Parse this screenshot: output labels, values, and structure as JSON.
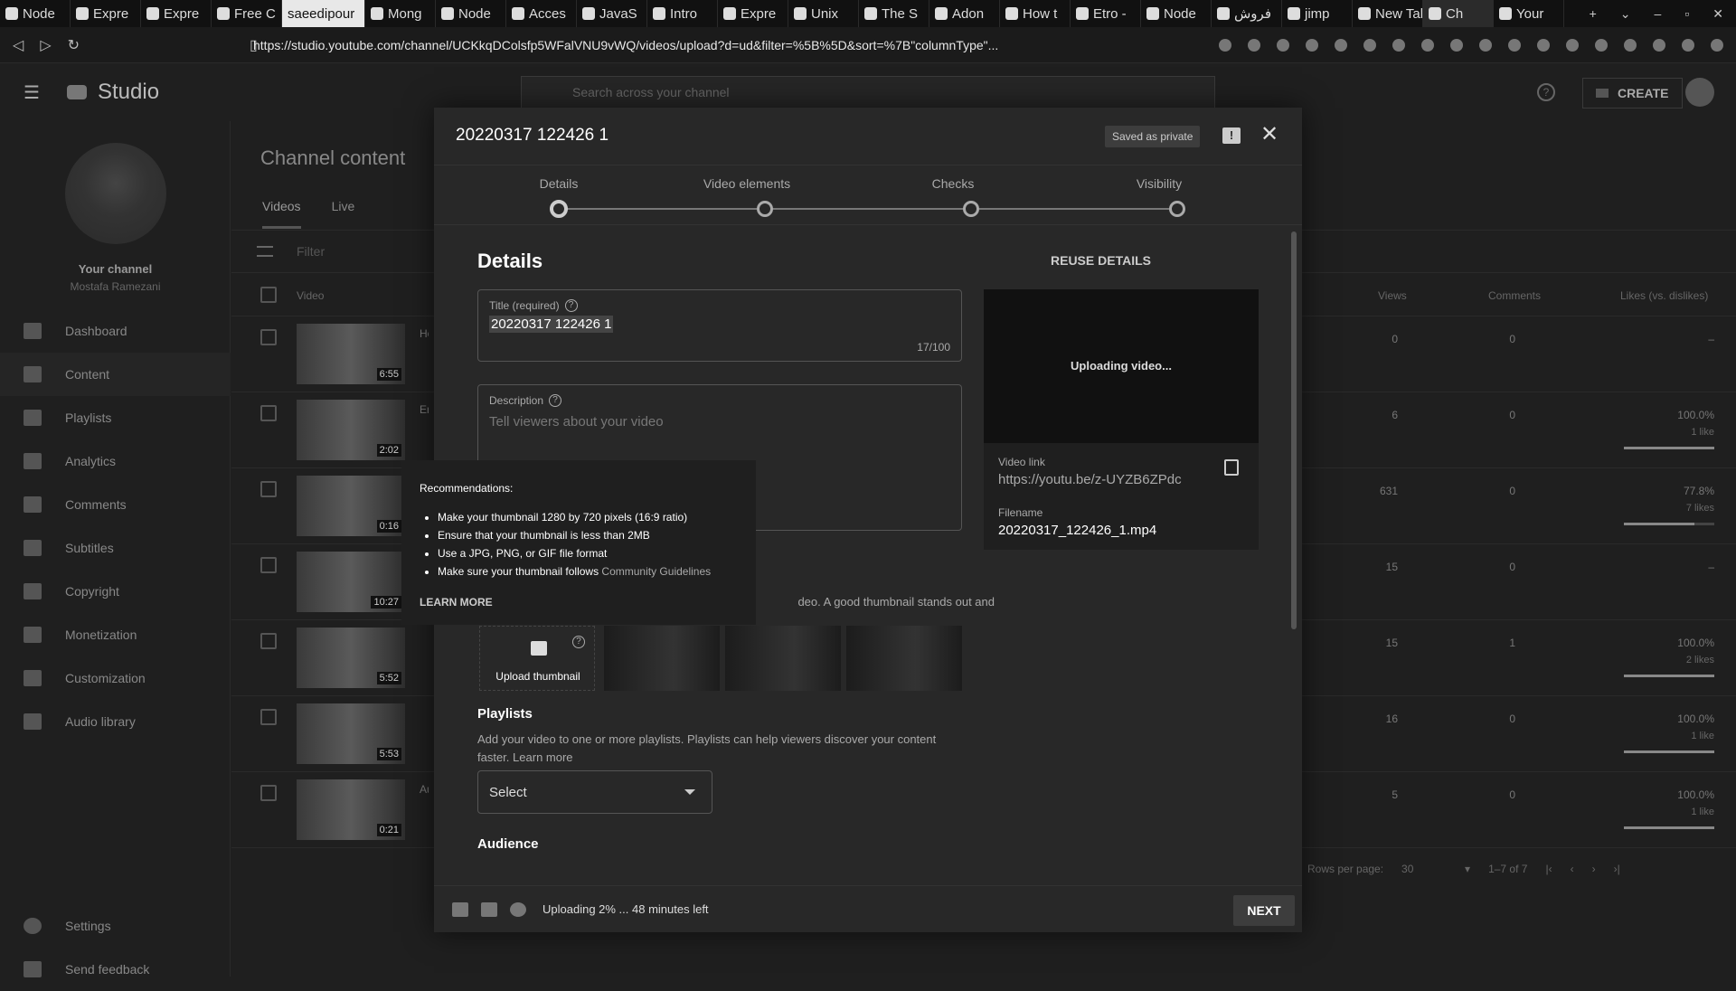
{
  "browser": {
    "tabs": [
      "Node",
      "Expre",
      "Expre",
      "Free C",
      "saeedipour",
      "Mong",
      "Node",
      "Acces",
      "JavaS",
      "Intro",
      "Expre",
      "Unix",
      "The S",
      "Adon",
      "How t",
      "Etro -",
      "Node",
      "فروش",
      "jimp",
      "New Tab",
      "Ch",
      "Your"
    ],
    "active_tab_index": 4,
    "url": "https://studio.youtube.com/channel/UCKkqDColsfp5WFalVNU9vWQ/videos/upload?d=ud&filter=%5B%5D&sort=%7B\"columnType\"..."
  },
  "studio": {
    "logo_text": "Studio",
    "search_placeholder": "Search across your channel",
    "create_label": "CREATE"
  },
  "sidebar": {
    "channel_title": "Your channel",
    "channel_name": "Mostafa Ramezani",
    "items": [
      {
        "label": "Dashboard",
        "icon": "dashboard-icon"
      },
      {
        "label": "Content",
        "icon": "content-icon"
      },
      {
        "label": "Playlists",
        "icon": "playlists-icon"
      },
      {
        "label": "Analytics",
        "icon": "analytics-icon"
      },
      {
        "label": "Comments",
        "icon": "comments-icon"
      },
      {
        "label": "Subtitles",
        "icon": "subtitles-icon"
      },
      {
        "label": "Copyright",
        "icon": "copyright-icon"
      },
      {
        "label": "Monetization",
        "icon": "monetization-icon"
      },
      {
        "label": "Customization",
        "icon": "customization-icon"
      },
      {
        "label": "Audio library",
        "icon": "audio-library-icon"
      }
    ],
    "settings": "Settings",
    "feedback": "Send feedback"
  },
  "content": {
    "title": "Channel content",
    "tabs": [
      "Videos",
      "Live"
    ],
    "filter_placeholder": "Filter",
    "columns": {
      "video": "Video",
      "views": "Views",
      "comments": "Comments",
      "likes": "Likes (vs. dislikes)"
    },
    "rows": [
      {
        "duration": "6:55",
        "title_start": "Ho",
        "views": "0",
        "comments": "0",
        "likes": "–",
        "likes_sub": "",
        "like_ratio": 0
      },
      {
        "duration": "2:02",
        "title_start": "En",
        "views": "6",
        "comments": "0",
        "likes": "100.0%",
        "likes_sub": "1 like",
        "like_ratio": 1.0
      },
      {
        "duration": "0:16",
        "title_start": "",
        "views": "631",
        "comments": "0",
        "likes": "77.8%",
        "likes_sub": "7 likes",
        "like_ratio": 0.778
      },
      {
        "duration": "10:27",
        "title_start": "",
        "views": "15",
        "comments": "0",
        "likes": "–",
        "likes_sub": "",
        "like_ratio": 0
      },
      {
        "duration": "5:52",
        "title_start": "",
        "views": "15",
        "comments": "1",
        "likes": "100.0%",
        "likes_sub": "2 likes",
        "like_ratio": 1.0
      },
      {
        "duration": "5:53",
        "title_start": "",
        "views": "16",
        "comments": "0",
        "likes": "100.0%",
        "likes_sub": "1 like",
        "like_ratio": 1.0
      },
      {
        "duration": "0:21",
        "title_start": "Au",
        "views": "5",
        "comments": "0",
        "likes": "100.0%",
        "likes_sub": "1 like",
        "like_ratio": 1.0
      }
    ],
    "rows_per_page_label": "Rows per page:",
    "rows_per_page": "30",
    "range": "1–7 of 7"
  },
  "dialog": {
    "title": "20220317 122426 1",
    "saved_badge": "Saved as private",
    "steps": [
      "Details",
      "Video elements",
      "Checks",
      "Visibility"
    ],
    "details_heading": "Details",
    "reuse": "REUSE DETAILS",
    "title_label": "Title (required)",
    "title_value": "20220317 122426 1",
    "title_counter": "17/100",
    "description_label": "Description",
    "description_placeholder": "Tell viewers about your video",
    "preview_status": "Uploading video...",
    "video_link_label": "Video link",
    "video_link": "https://youtu.be/z-UYZB6ZPdc",
    "filename_label": "Filename",
    "filename": "20220317_122426_1.mp4",
    "thumbnail_text": "deo. A good thumbnail stands out and",
    "upload_thumbnail": "Upload thumbnail",
    "playlists_heading": "Playlists",
    "playlists_desc": "Add your video to one or more playlists. Playlists can help viewers discover your content faster.",
    "learn_more": "Learn more",
    "select_label": "Select",
    "audience_heading": "Audience",
    "upload_status": "Uploading 2% ... 48 minutes left",
    "next": "NEXT"
  },
  "tooltip": {
    "heading": "Recommendations:",
    "items": [
      "Make your thumbnail 1280 by 720 pixels (16:9 ratio)",
      "Ensure that your thumbnail is less than 2MB",
      "Use a JPG, PNG, or GIF file format",
      "Make sure your thumbnail follows"
    ],
    "link": "Community Guidelines",
    "learn_more": "LEARN MORE"
  }
}
